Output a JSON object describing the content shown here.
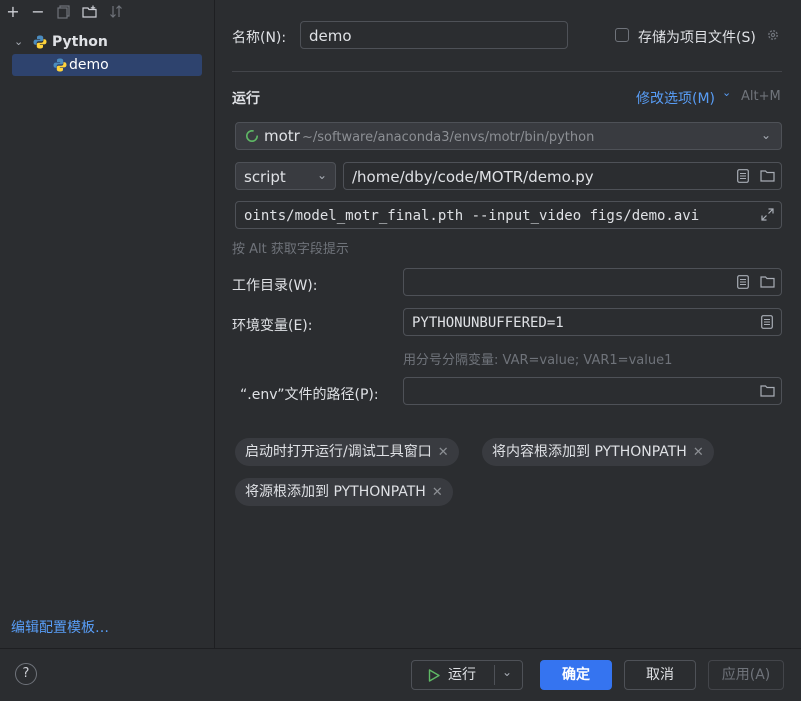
{
  "sidebar": {
    "tree": {
      "group_label": "Python",
      "item_label": "demo"
    },
    "edit_templates_link": "编辑配置模板…"
  },
  "form": {
    "name_label": "名称(N):",
    "name_value": "demo",
    "store_as_project_file": "存储为项目文件(S)",
    "run_section_title": "运行",
    "modify_options": "修改选项(M)",
    "modify_options_shortcut": "Alt+M",
    "interpreter": {
      "name": "motr",
      "path": "~/software/anaconda3/envs/motr/bin/python"
    },
    "script_type": "script",
    "script_path": "/home/dby/code/MOTR/demo.py",
    "parameters": "oints/model_motr_final.pth --input_video figs/demo.avi",
    "alt_hint": "按 Alt 获取字段提示",
    "working_dir_label": "工作目录(W):",
    "working_dir_value": "",
    "env_vars_label": "环境变量(E):",
    "env_vars_value": "PYTHONUNBUFFERED=1",
    "env_vars_hint": "用分号分隔变量: VAR=value; VAR1=value1",
    "env_file_label": "“.env”文件的路径(P):",
    "env_file_value": "",
    "chips": [
      "启动时打开运行/调试工具窗口",
      "将内容根添加到 PYTHONPATH",
      "将源根添加到 PYTHONPATH"
    ]
  },
  "footer": {
    "help": "?",
    "run": "运行",
    "ok": "确定",
    "cancel": "取消",
    "apply": "应用(A)"
  },
  "colors": {
    "accent": "#3574f0",
    "link": "#589df6",
    "background": "#2b2d30"
  }
}
